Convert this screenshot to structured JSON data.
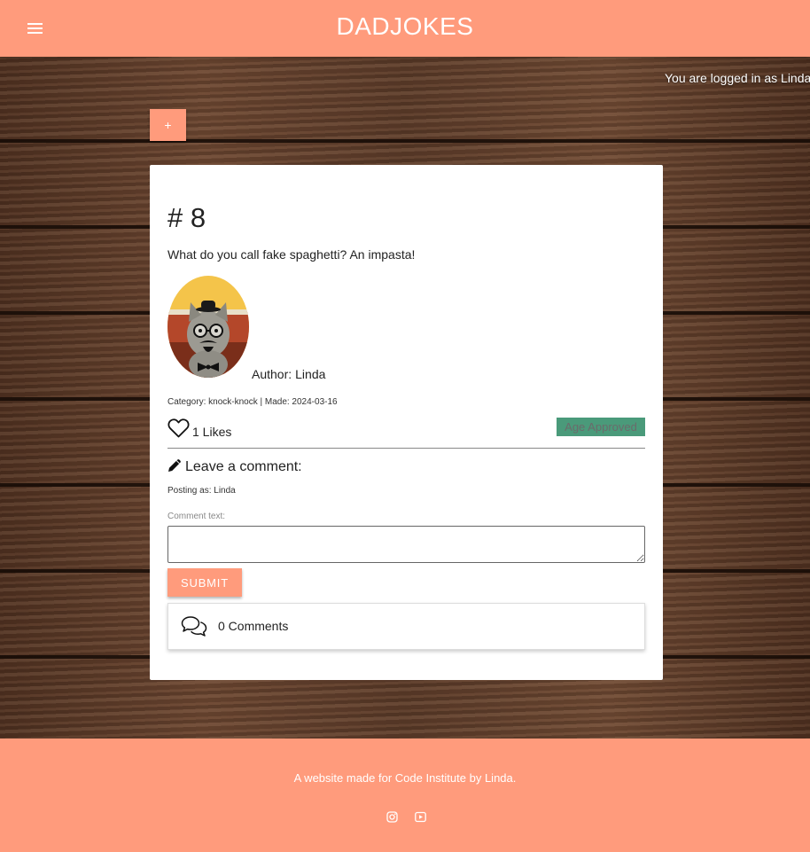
{
  "header": {
    "brand": "DADJOKES",
    "menu_icon": "hamburger-menu-icon"
  },
  "session": {
    "status": "You are logged in as Linda"
  },
  "toolbar": {
    "add_label": "+"
  },
  "joke": {
    "title": "# 8",
    "text": "What do you call fake spaghetti? An impasta!",
    "author_label": "Author:",
    "author": "Linda",
    "meta": "Category: knock-knock | Made: 2024-03-16",
    "likes": "1 Likes",
    "approval": "Age Approved"
  },
  "comment_form": {
    "heading": "Leave a comment:",
    "posting_as": "Posting as: Linda",
    "field_label": "Comment text:",
    "value": "",
    "submit_label": "SUBMIT"
  },
  "comments": {
    "count_label": "0 Comments"
  },
  "footer": {
    "text": "A website made for Code Institute by Linda.",
    "social": [
      "instagram-icon",
      "youtube-icon"
    ]
  },
  "colors": {
    "accent": "#ff9b7c",
    "approval": "#4a9a7a"
  }
}
